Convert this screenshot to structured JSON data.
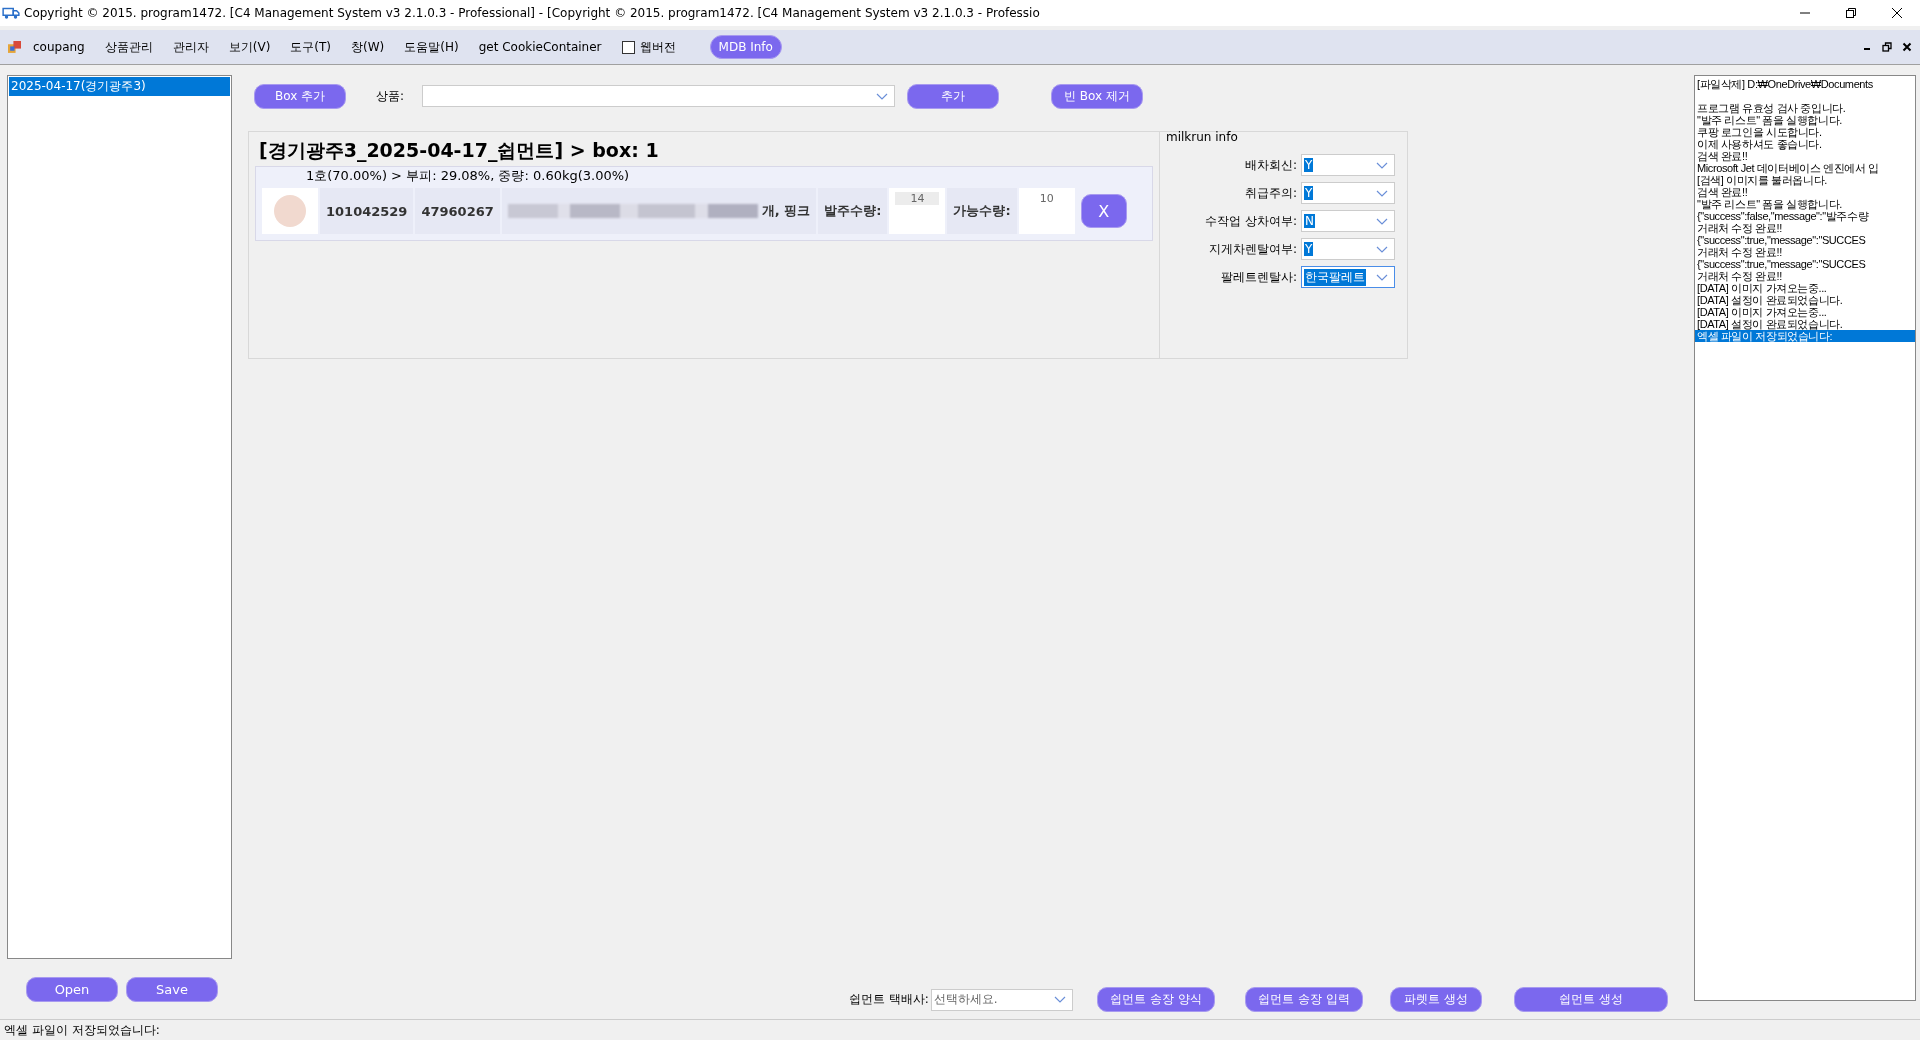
{
  "window": {
    "title": "Copyright © 2015. program1472. [C4 Management System v3 2.1.0.3 - Professional] - [Copyright © 2015. program1472. [C4 Management System v3 2.1.0.3 - Professio"
  },
  "menu": {
    "items": [
      {
        "label": "coupang"
      },
      {
        "label": "상품관리"
      },
      {
        "label": "관리자"
      },
      {
        "label": "보기(V)"
      },
      {
        "label": "도구(T)"
      },
      {
        "label": "창(W)"
      },
      {
        "label": "도움말(H)"
      },
      {
        "label": "get CookieContainer"
      }
    ],
    "web_version": {
      "label": "웹버전",
      "checked": false
    },
    "mdb_button": "MDB Info"
  },
  "sidebar": {
    "items": [
      {
        "label": "2025-04-17(경기광주3)",
        "selected": true
      }
    ],
    "buttons": [
      "Open",
      "Save"
    ]
  },
  "toolbar": {
    "add_box": "Box 추가",
    "product_label": "상품:",
    "add": "추가",
    "remove_empty": "빈 Box 제거"
  },
  "shipment": {
    "title": "[경기광주3_2025-04-17_쉽먼트] > box: 1",
    "box_summary": "1호(70.00%) > 부피: 29.08%, 중량: 0.60kg(3.00%)",
    "items": [
      {
        "code_1": "101042529",
        "code_2": "47960267",
        "name_tail": "개, 핑크",
        "order_qty_label": "발주수량:",
        "order_qty": "14",
        "available_label": "가능수량:",
        "available": "10",
        "delete": "X"
      }
    ]
  },
  "milkrun": {
    "title": "milkrun info",
    "fields": [
      {
        "label": "배차회신:",
        "value": "Y",
        "focused": false
      },
      {
        "label": "취급주의:",
        "value": "Y",
        "focused": false
      },
      {
        "label": "수작업 상차여부:",
        "value": "N",
        "focused": false
      },
      {
        "label": "지게차렌탈여부:",
        "value": "Y",
        "focused": false
      },
      {
        "label": "팔레트렌탈사:",
        "value": "한국팔레트",
        "focused": true
      }
    ]
  },
  "bottom": {
    "carrier_label": "쉽먼트 택배사:",
    "carrier_placeholder": "선택하세요.",
    "buttons": [
      "쉽먼트 송장 양식",
      "쉽먼트 송장 입력",
      "파렛트 생성",
      "쉽먼트 생성"
    ]
  },
  "log": {
    "lines": [
      {
        "text": "[파일삭제] D:₩OneDrive₩Documents",
        "selected": false
      },
      {
        "text": "프로그램 유효성 검사 중입니다.",
        "selected": false
      },
      {
        "text": "\"발주 리스트\" 폼을 실행합니다.",
        "selected": false
      },
      {
        "text": "쿠팡 로그인을 시도합니다.",
        "selected": false
      },
      {
        "text": "이제 사용하셔도 좋습니다.",
        "selected": false
      },
      {
        "text": "검색 완료!!",
        "selected": false
      },
      {
        "text": "Microsoft Jet 데이터베이스 엔진에서 입",
        "selected": false
      },
      {
        "text": "[검색] 이미지를 불러옵니다.",
        "selected": false
      },
      {
        "text": "검색 완료!!",
        "selected": false
      },
      {
        "text": "\"발주 리스트\" 폼을 실행합니다.",
        "selected": false
      },
      {
        "text": "{\"success\":false,\"message\":\"발주수량",
        "selected": false
      },
      {
        "text": "거래처 수정 완료!!",
        "selected": false
      },
      {
        "text": "{\"success\":true,\"message\":\"SUCCES",
        "selected": false
      },
      {
        "text": "거래처 수정 완료!!",
        "selected": false
      },
      {
        "text": "{\"success\":true,\"message\":\"SUCCES",
        "selected": false
      },
      {
        "text": "거래처 수정 완료!!",
        "selected": false
      },
      {
        "text": "[DATA] 이미지 가져오는중...",
        "selected": false
      },
      {
        "text": "[DATA] 설정이 완료되었습니다.",
        "selected": false
      },
      {
        "text": "[DATA] 이미지 가져오는중...",
        "selected": false
      },
      {
        "text": "[DATA] 설정이 완료되었습니다.",
        "selected": false
      },
      {
        "text": "엑셀 파일이 저장되었습니다:",
        "selected": true
      }
    ]
  },
  "status_bar": {
    "text": "엑셀 파일이 저장되었습니다:"
  }
}
